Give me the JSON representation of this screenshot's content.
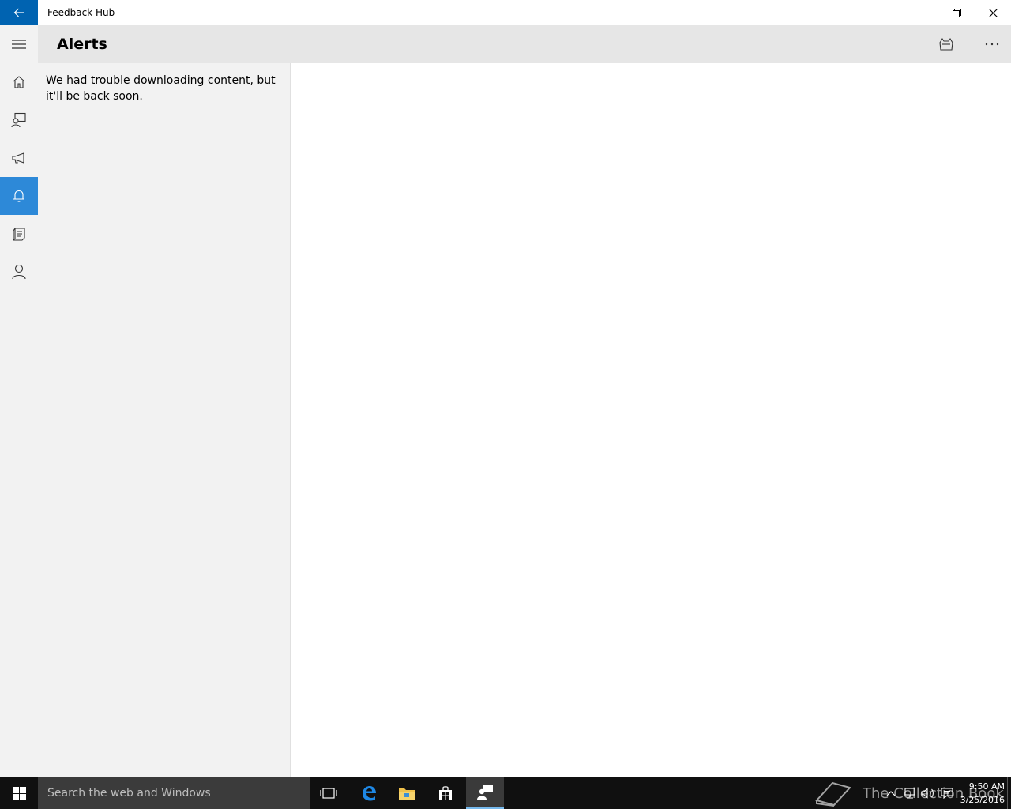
{
  "window": {
    "title": "Feedback Hub"
  },
  "header": {
    "title": "Alerts"
  },
  "nav": {
    "items": [
      {
        "name": "home",
        "icon": "home-icon"
      },
      {
        "name": "feedback",
        "icon": "feedback-icon"
      },
      {
        "name": "announcements",
        "icon": "megaphone-icon"
      },
      {
        "name": "alerts",
        "icon": "bell-icon",
        "active": true
      },
      {
        "name": "quests",
        "icon": "quest-icon"
      },
      {
        "name": "profile",
        "icon": "person-icon"
      }
    ]
  },
  "list": {
    "message": "We had trouble downloading content, but it'll be back soon."
  },
  "taskbar": {
    "search_placeholder": "Search the web and Windows",
    "time": "9:50 AM",
    "date": "3/25/2016",
    "watermark": "The Collection Book"
  },
  "colors": {
    "accent": "#0063b1",
    "nav_active": "#2d89d8",
    "header_bg": "#e6e6e6",
    "pane_bg": "#f2f2f2",
    "taskbar_bg": "#101010"
  }
}
